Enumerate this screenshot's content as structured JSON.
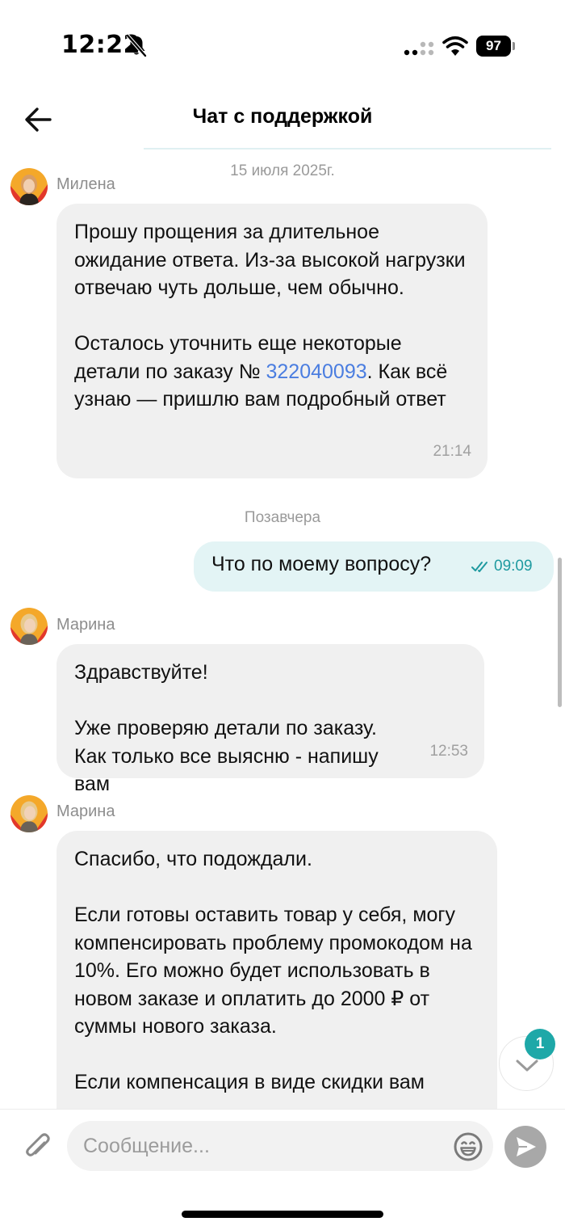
{
  "status_bar": {
    "time": "12:22",
    "battery": "97"
  },
  "header": {
    "title": "Чат с поддержкой"
  },
  "messages": {
    "date_1": "15 июля 2025г.",
    "msg_1": {
      "sender": "Милена",
      "p1": "Прошу прощения за длительное ожидание ответа. Из-за высокой нагрузки отвечаю чуть дольше, чем обычно.",
      "p2_before": "Осталось уточнить еще некоторые детали по заказу № ",
      "order_number": "322040093",
      "p2_after": ". Как всё узнаю — пришлю вам подробный ответ",
      "time": "21:14"
    },
    "date_2": "Позавчера",
    "outgoing": {
      "text": "Что по моему вопросу?",
      "time": "09:09"
    },
    "msg_2": {
      "sender": "Марина",
      "p1": "Здравствуйте!",
      "p2": "Уже проверяю детали по заказу. Как только все выясню - напишу вам",
      "time": "12:53"
    },
    "msg_3": {
      "sender": "Марина",
      "p1": "Спасибо, что подождали.",
      "p2": "Если готовы оставить товар у себя, могу компенсировать проблему промокодом на 10%. Его можно будет использовать в новом заказе и оплатить до 2000 ₽ от суммы нового заказа.",
      "p3": "Если компенсация в виде скидки вам"
    }
  },
  "scroll_badge": "1",
  "input": {
    "placeholder": "Сообщение..."
  },
  "colors": {
    "accent": "#1ea8a8",
    "link": "#4a7de0",
    "outgoing_bubble": "#e3f4f5",
    "incoming_bubble": "#f0f0f0"
  }
}
